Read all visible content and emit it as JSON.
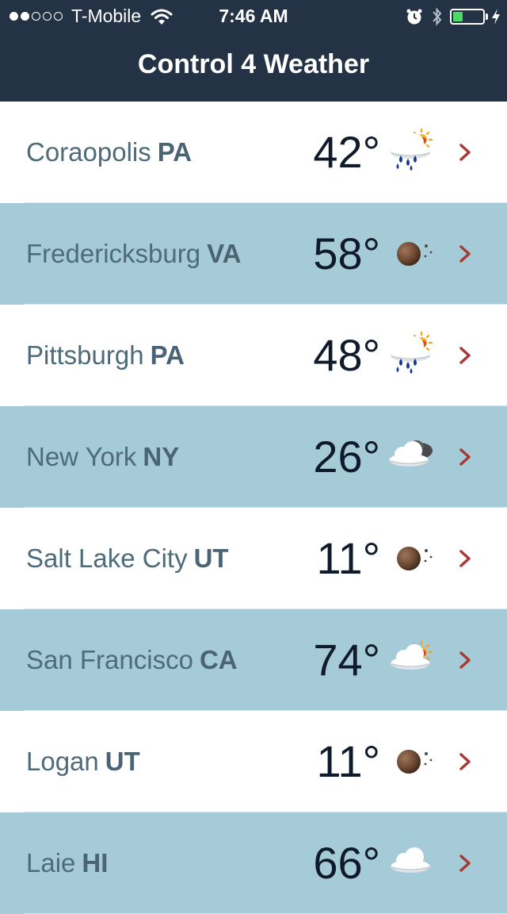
{
  "status_bar": {
    "carrier": "T-Mobile",
    "time": "7:46 AM",
    "signal_bars_filled": 2,
    "signal_bars_total": 5,
    "battery_level": 0.4
  },
  "header": {
    "title": "Control 4 Weather"
  },
  "locations": [
    {
      "city": "Coraopolis",
      "state": "PA",
      "temp": "42°",
      "icon": "rain-sun-icon"
    },
    {
      "city": "Fredericksburg",
      "state": "VA",
      "temp": "58°",
      "icon": "clear-night-icon"
    },
    {
      "city": "Pittsburgh",
      "state": "PA",
      "temp": "48°",
      "icon": "rain-sun-icon"
    },
    {
      "city": "New York",
      "state": "NY",
      "temp": "26°",
      "icon": "cloudy-night-icon"
    },
    {
      "city": "Salt Lake City",
      "state": "UT",
      "temp": "11°",
      "icon": "clear-night-icon"
    },
    {
      "city": "San Francisco",
      "state": "CA",
      "temp": "74°",
      "icon": "partly-sunny-icon"
    },
    {
      "city": "Logan",
      "state": "UT",
      "temp": "11°",
      "icon": "clear-night-icon"
    },
    {
      "city": "Laie",
      "state": "HI",
      "temp": "66°",
      "icon": "cloud-icon"
    }
  ],
  "colors": {
    "header_bg": "#243245",
    "row_alt_bg": "#a5cbd8",
    "chevron": "#a83a35",
    "battery_fill": "#4cd964"
  }
}
